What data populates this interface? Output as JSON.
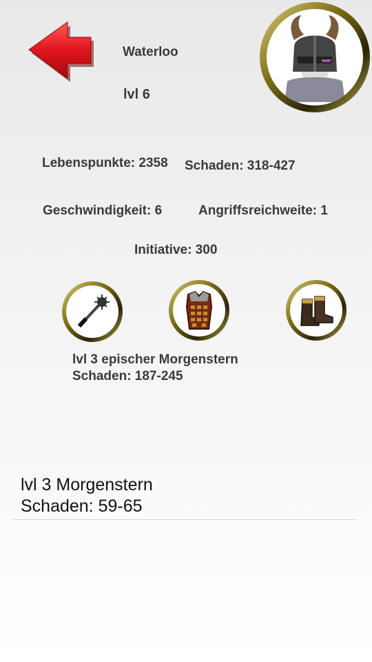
{
  "hero": {
    "name": "Waterloo",
    "level": "lvl 6",
    "avatar_icon": "horned-helmet-warrior-icon"
  },
  "stats": {
    "health": "Lebenspunkte: 2358",
    "damage": "Schaden: 318-427",
    "speed": "Geschwindigkeit: 6",
    "range": "Angriffsreichweite: 1",
    "initiative": "Initiative: 300"
  },
  "equipment": [
    {
      "icon": "morningstar-icon"
    },
    {
      "icon": "chainmail-armor-icon"
    },
    {
      "icon": "boots-icon"
    }
  ],
  "selected_item": {
    "line1": "lvl 3 epischer Morgenstern",
    "line2": "Schaden: 187-245"
  },
  "inventory": [
    {
      "line1": "lvl 3 Morgenstern",
      "line2": "Schaden: 59-65"
    }
  ],
  "colors": {
    "back_arrow": "#e0141c",
    "ring_gold": "#b5a63a"
  }
}
